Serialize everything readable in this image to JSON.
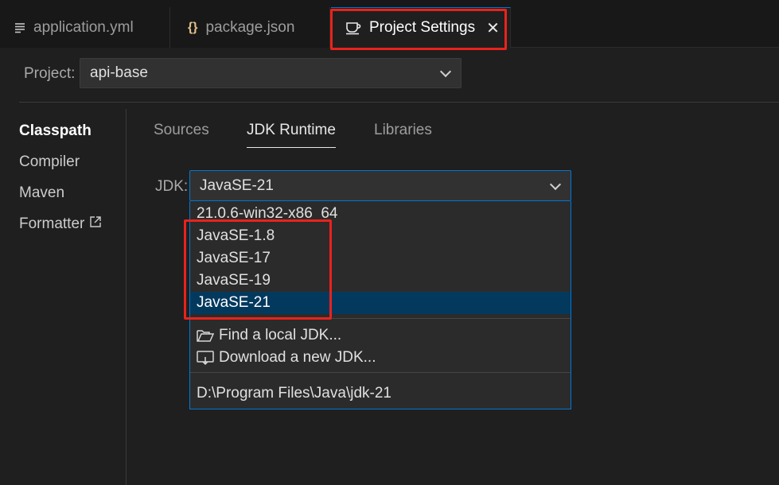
{
  "tabs": [
    {
      "label": "application.yml",
      "icon": "lines-icon"
    },
    {
      "label": "package.json",
      "icon": "braces-icon"
    },
    {
      "label": "Project Settings",
      "icon": "coffee-cup-icon",
      "active": true
    }
  ],
  "project": {
    "label": "Project:",
    "value": "api-base"
  },
  "nav": {
    "items": [
      "Classpath",
      "Compiler",
      "Maven",
      "Formatter"
    ],
    "active": "Classpath"
  },
  "subtabs": {
    "items": [
      "Sources",
      "JDK Runtime",
      "Libraries"
    ],
    "active": "JDK Runtime"
  },
  "jdk": {
    "label": "JDK:",
    "value": "JavaSE-21",
    "options_partial": "21.0.6-win32-x86_64",
    "options": [
      "JavaSE-1.8",
      "JavaSE-17",
      "JavaSE-19",
      "JavaSE-21"
    ],
    "selected": "JavaSE-21",
    "actions": [
      "Find a local JDK...",
      "Download a new JDK..."
    ],
    "path": "D:\\Program Files\\Java\\jdk-21"
  },
  "colors": {
    "accent": "#0078d4",
    "highlight": "#e8231c",
    "selected_bg": "#04395e"
  }
}
